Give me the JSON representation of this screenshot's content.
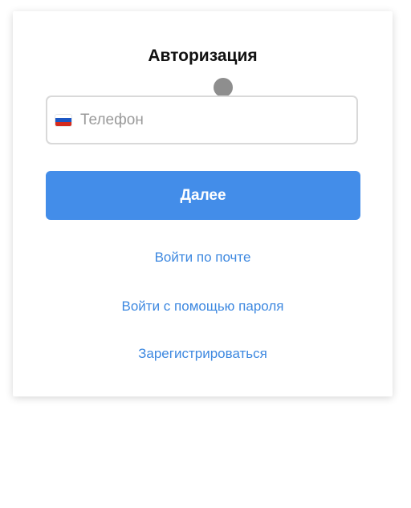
{
  "form": {
    "title": "Авторизация",
    "phone": {
      "value": "",
      "placeholder": "Телефон",
      "country_flag": "russia-flag-icon"
    },
    "next_label": "Далее",
    "links": {
      "login_email": "Войти по почте",
      "login_password": "Войти с помощью пароля",
      "register": "Зарегистрироваться"
    }
  },
  "colors": {
    "primary": "#438de9",
    "link": "#3d88e0",
    "border": "#d9d9d9"
  }
}
